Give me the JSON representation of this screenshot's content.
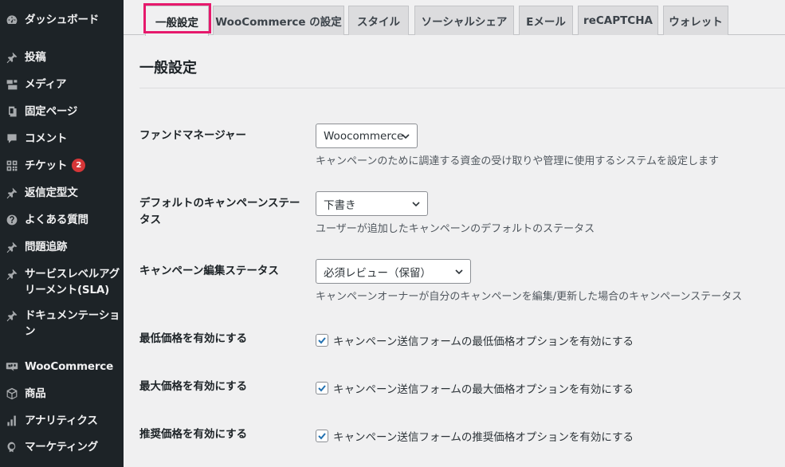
{
  "sidebar": {
    "items": [
      {
        "label": "ダッシュボード",
        "icon": "dashboard-icon"
      },
      {
        "label": "投稿",
        "icon": "pin-icon"
      },
      {
        "label": "メディア",
        "icon": "media-icon"
      },
      {
        "label": "固定ページ",
        "icon": "page-icon"
      },
      {
        "label": "コメント",
        "icon": "comment-icon"
      },
      {
        "label": "チケット",
        "icon": "grid-icon",
        "badge": "2"
      },
      {
        "label": "返信定型文",
        "icon": "pin-icon"
      },
      {
        "label": "よくある質問",
        "icon": "help-icon"
      },
      {
        "label": "問題追跡",
        "icon": "pin-icon"
      },
      {
        "label": "サービスレベルアグリーメント(SLA)",
        "line1": "サービスレベルアグ",
        "line2": "リーメント(SLA)",
        "icon": "pin-icon"
      },
      {
        "label": "ドキュメンテーション",
        "line1": "ドキュメンテーショ",
        "line2": "ン",
        "icon": "pin-icon"
      },
      {
        "label": "WooCommerce",
        "icon": "woo-icon"
      },
      {
        "label": "商品",
        "icon": "box-icon"
      },
      {
        "label": "アナリティクス",
        "icon": "bar-chart-icon"
      },
      {
        "label": "マーケティング",
        "icon": "megaphone-icon"
      }
    ]
  },
  "tabs": [
    {
      "label": "一般設定",
      "active": true
    },
    {
      "label": "WooCommerce の設定"
    },
    {
      "label": "スタイル"
    },
    {
      "label": "ソーシャルシェア"
    },
    {
      "label": "Eメール"
    },
    {
      "label": "reCAPTCHA"
    },
    {
      "label": "ウォレット"
    }
  ],
  "main": {
    "title": "一般設定",
    "fields": {
      "fund_manager": {
        "label": "ファンドマネージャー",
        "value": "Woocommerce",
        "description": "キャンペーンのために調達する資金の受け取りや管理に使用するシステムを設定します"
      },
      "default_status": {
        "label_line1": "デフォルトのキャンペーンステー",
        "label_line2": "タス",
        "value": "下書き",
        "description": "ユーザーが追加したキャンペーンのデフォルトのステータス"
      },
      "edit_status": {
        "label": "キャンペーン編集ステータス",
        "value": "必須レビュー（保留）",
        "description": "キャンペーンオーナーが自分のキャンペーンを編集/更新した場合のキャンペーンステータス"
      },
      "min_price": {
        "label": "最低価格を有効にする",
        "checkbox_label": "キャンペーン送信フォームの最低価格オプションを有効にする",
        "checked": true
      },
      "max_price": {
        "label": "最大価格を有効にする",
        "checkbox_label": "キャンペーン送信フォームの最大価格オプションを有効にする",
        "checked": true
      },
      "recommended_price": {
        "label": "推奨価格を有効にする",
        "checkbox_label": "キャンペーン送信フォームの推奨価格オプションを有効にする",
        "checked": true
      }
    }
  },
  "colors": {
    "sidebar_bg": "#1d2327",
    "page_bg": "#f0f0f1",
    "highlight": "#e6196c",
    "badge": "#d63638",
    "checkbox_check": "#2271b1"
  }
}
